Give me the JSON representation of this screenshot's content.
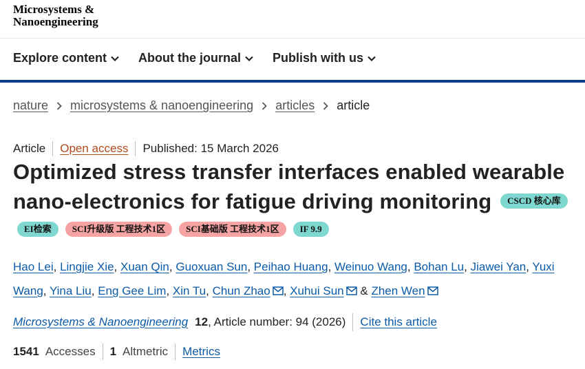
{
  "logo": {
    "line1": "Microsystems &",
    "line2": "Nanoengineering"
  },
  "nav": [
    {
      "label": "Explore content"
    },
    {
      "label": "About the journal"
    },
    {
      "label": "Publish with us"
    }
  ],
  "breadcrumb": {
    "items": [
      "nature",
      "microsystems & nanoengineering",
      "articles"
    ],
    "current": "article"
  },
  "meta": {
    "type": "Article",
    "access": "Open access",
    "published": "Published: 15 March 2026"
  },
  "title": "Optimized stress transfer interfaces enabled wearable nano-electronics for fatigue driving monitoring",
  "badges": {
    "cscd": "CSCD 核心库",
    "row": [
      "EI检索",
      "SCI升级版 工程技术1区",
      "SCI基础版 工程技术1区",
      "IF 9.9"
    ]
  },
  "authors": [
    "Hao Lei",
    "Lingjie Xie",
    "Xuan Qin",
    "Guoxuan Sun",
    "Peihao Huang",
    "Weinuo Wang",
    "Bohan Lu",
    "Jiawei Yan",
    "Yuxi Wang",
    "Yina Liu",
    "Eng Gee Lim",
    "Xin Tu",
    "Chun Zhao",
    "Xuhui Sun",
    "Zhen Wen"
  ],
  "authors_sep": ",",
  "authors_and": "&",
  "journal": {
    "name": "Microsystems & Nanoengineering",
    "volume": "12",
    "article_number": ", Article number: 94 (2026)",
    "cite": "Cite this article"
  },
  "metrics": {
    "accesses_value": "1541",
    "accesses_label": "Accesses",
    "altmetric_value": "1",
    "altmetric_label": "Altmetric",
    "link": "Metrics"
  },
  "colors": {
    "brand_blue": "#0d3c8f",
    "link": "#0c5aa6",
    "open_access": "#b04a1a",
    "badge_teal": "#7fd8cf",
    "badge_pink": "#f5a3a3"
  }
}
